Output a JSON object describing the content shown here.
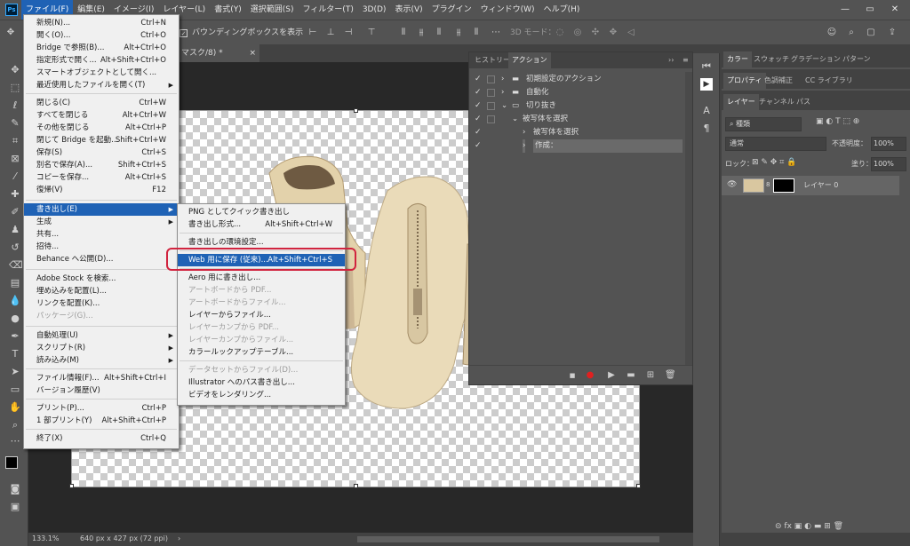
{
  "menubar": {
    "logo": "Ps",
    "items": [
      "ファイル(F)",
      "編集(E)",
      "イメージ(I)",
      "レイヤー(L)",
      "書式(Y)",
      "選択範囲(S)",
      "フィルター(T)",
      "3D(D)",
      "表示(V)",
      "プラグイン",
      "ウィンドウ(W)",
      "ヘルプ(H)"
    ],
    "window_controls": [
      "—",
      "▭",
      "✕"
    ]
  },
  "options_bar": {
    "bounding_box_label": "バウンディングボックスを表示",
    "mode_3d_label": "3D モード："
  },
  "document_tab": {
    "label": "マスク/8) *",
    "close": "×"
  },
  "status_bar": {
    "zoom": "133.1%",
    "doc_info": "640 px x 427 px (72 ppi)",
    "arrow": "›"
  },
  "file_menu": {
    "items": [
      {
        "label": "新規(N)...",
        "shortcut": "Ctrl+N"
      },
      {
        "label": "開く(O)...",
        "shortcut": "Ctrl+O"
      },
      {
        "label": "Bridge で参照(B)...",
        "shortcut": "Alt+Ctrl+O"
      },
      {
        "label": "指定形式で開く...",
        "shortcut": "Alt+Shift+Ctrl+O"
      },
      {
        "label": "スマートオブジェクトとして開く...",
        "shortcut": ""
      },
      {
        "label": "最近使用したファイルを開く(T)",
        "shortcut": "",
        "submenu": true
      },
      {
        "label": "閉じる(C)",
        "shortcut": "Ctrl+W"
      },
      {
        "label": "すべてを閉じる",
        "shortcut": "Alt+Ctrl+W"
      },
      {
        "label": "その他を閉じる",
        "shortcut": "Alt+Ctrl+P"
      },
      {
        "label": "閉じて Bridge を起動...",
        "shortcut": "Shift+Ctrl+W"
      },
      {
        "label": "保存(S)",
        "shortcut": "Ctrl+S"
      },
      {
        "label": "別名で保存(A)...",
        "shortcut": "Shift+Ctrl+S"
      },
      {
        "label": "コピーを保存...",
        "shortcut": "Alt+Ctrl+S"
      },
      {
        "label": "復帰(V)",
        "shortcut": "F12"
      },
      {
        "label": "書き出し(E)",
        "shortcut": "",
        "submenu": true,
        "highlighted": true
      },
      {
        "label": "生成",
        "shortcut": "",
        "submenu": true
      },
      {
        "label": "共有...",
        "shortcut": ""
      },
      {
        "label": "招待...",
        "shortcut": ""
      },
      {
        "label": "Behance へ公開(D)...",
        "shortcut": ""
      },
      {
        "label": "Adobe Stock を検索...",
        "shortcut": ""
      },
      {
        "label": "埋め込みを配置(L)...",
        "shortcut": ""
      },
      {
        "label": "リンクを配置(K)...",
        "shortcut": ""
      },
      {
        "label": "パッケージ(G)...",
        "shortcut": "",
        "disabled": true
      },
      {
        "label": "自動処理(U)",
        "shortcut": "",
        "submenu": true
      },
      {
        "label": "スクリプト(R)",
        "shortcut": "",
        "submenu": true
      },
      {
        "label": "読み込み(M)",
        "shortcut": "",
        "submenu": true
      },
      {
        "label": "ファイル情報(F)...",
        "shortcut": "Alt+Shift+Ctrl+I"
      },
      {
        "label": "バージョン履歴(V)",
        "shortcut": ""
      },
      {
        "label": "プリント(P)...",
        "shortcut": "Ctrl+P"
      },
      {
        "label": "1 部プリント(Y)",
        "shortcut": "Alt+Shift+Ctrl+P"
      },
      {
        "label": "終了(X)",
        "shortcut": "Ctrl+Q"
      }
    ]
  },
  "export_submenu": {
    "items": [
      {
        "label": "PNG としてクイック書き出し",
        "shortcut": ""
      },
      {
        "label": "書き出し形式...",
        "shortcut": "Alt+Shift+Ctrl+W"
      },
      {
        "label": "書き出しの環境設定...",
        "shortcut": ""
      },
      {
        "label": "Web 用に保存 (従来)...",
        "shortcut": "Alt+Shift+Ctrl+S",
        "highlighted": true
      },
      {
        "label": "Aero 用に書き出し...",
        "shortcut": ""
      },
      {
        "label": "アートボードから PDF...",
        "shortcut": "",
        "disabled": true
      },
      {
        "label": "アートボードからファイル...",
        "shortcut": "",
        "disabled": true
      },
      {
        "label": "レイヤーからファイル...",
        "shortcut": ""
      },
      {
        "label": "レイヤーカンプから PDF...",
        "shortcut": "",
        "disabled": true
      },
      {
        "label": "レイヤーカンプからファイル...",
        "shortcut": "",
        "disabled": true
      },
      {
        "label": "カラールックアップテーブル...",
        "shortcut": ""
      },
      {
        "label": "データセットからファイル(D)...",
        "shortcut": "",
        "disabled": true
      },
      {
        "label": "Illustrator へのパス書き出し...",
        "shortcut": ""
      },
      {
        "label": "ビデオをレンダリング...",
        "shortcut": ""
      }
    ]
  },
  "actions_panel": {
    "tabs": [
      "ヒストリー",
      "アクション"
    ],
    "collapse": "››",
    "rows": [
      {
        "label": "初期設定のアクション",
        "expander": "›",
        "folder": true
      },
      {
        "label": "自動化",
        "expander": "›",
        "folder": true
      },
      {
        "label": "切り抜き",
        "expander": "⌄",
        "folder": true
      },
      {
        "label": "被写体を選択",
        "expander": "⌄",
        "folder": false
      },
      {
        "label": "被写体を選択",
        "expander": "›",
        "folder": false
      },
      {
        "label": "作成：",
        "expander": "›",
        "folder": false,
        "selected": true
      }
    ]
  },
  "right_panels": {
    "top_tabs": [
      "カラー",
      "スウォッチ",
      "グラデーション",
      "パターン"
    ],
    "mid_tabs": [
      "プロパティ",
      "色調補正",
      "CC ライブラリ"
    ],
    "layer_tabs": [
      "レイヤー",
      "チャンネル",
      "パス"
    ],
    "filter_kind": "種類",
    "blend_mode": "通常",
    "opacity_label": "不透明度：",
    "opacity_value": "100%",
    "lock_label": "ロック：",
    "fill_label": "塗り：",
    "fill_value": "100%",
    "layer_name": "レイヤー 0"
  },
  "colors": {
    "accent": "#1f62b5",
    "highlight_box": "#d1243f"
  }
}
